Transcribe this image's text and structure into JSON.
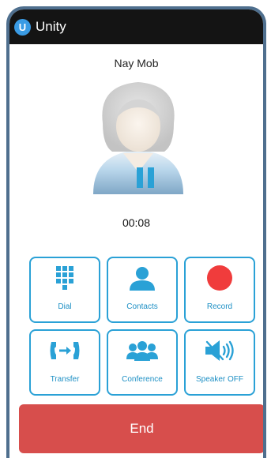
{
  "app": {
    "title": "Unity",
    "logo_letter": "U"
  },
  "call": {
    "caller_name": "Nay Mob",
    "timer": "00:08",
    "status_icon": "pause-icon"
  },
  "actions": [
    {
      "label": "Dial",
      "icon": "dialpad-icon"
    },
    {
      "label": "Contacts",
      "icon": "contact-icon"
    },
    {
      "label": "Record",
      "icon": "record-icon"
    },
    {
      "label": "Transfer",
      "icon": "transfer-icon"
    },
    {
      "label": "Conference",
      "icon": "conference-icon"
    },
    {
      "label": "Speaker OFF",
      "icon": "speaker-off-icon"
    }
  ],
  "end_button": {
    "label": "End"
  },
  "colors": {
    "accent": "#2aa1d6",
    "end": "#d74e4c",
    "record": "#f03c3c",
    "titlebar": "#141414",
    "frame": "#4f6f8e"
  }
}
